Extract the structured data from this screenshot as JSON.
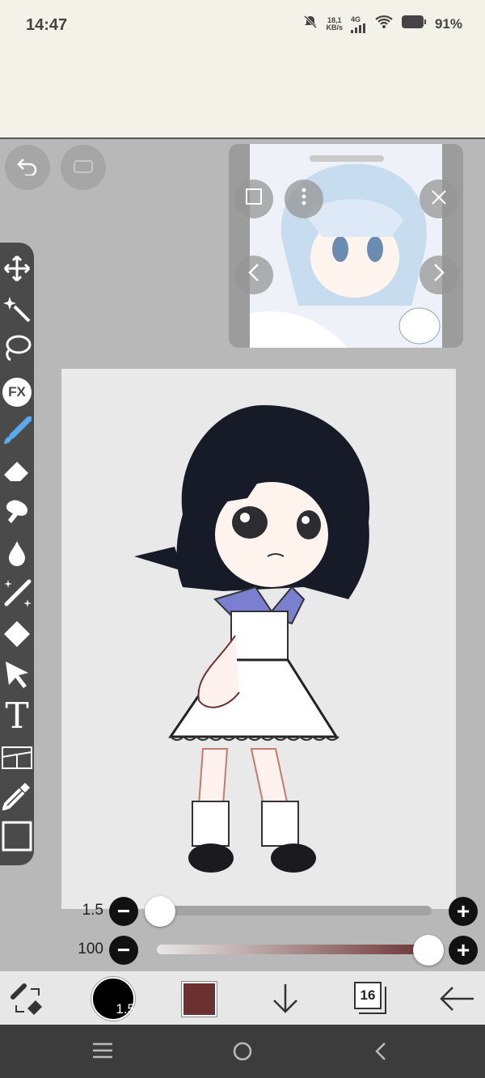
{
  "status": {
    "time": "14:47",
    "speed_top": "18,1",
    "speed_bottom": "KB/s",
    "network": "4G",
    "battery": "91%"
  },
  "colors": {
    "accent": "#6b3131",
    "toolbar": "#4a4a4a",
    "paper": "#e9e9e9"
  },
  "toolbar": {
    "tools": [
      "move-icon",
      "magic-wand-icon",
      "lasso-icon",
      "fx-icon",
      "brush-icon",
      "eraser-icon",
      "smudge-icon",
      "blur-icon",
      "shine-brush-icon",
      "fill-icon",
      "select-arrow-icon",
      "text-icon",
      "frame-divider-icon",
      "eyedropper-icon",
      "canvas-icon"
    ],
    "fx_label": "FX",
    "text_label": "T"
  },
  "sliders": {
    "brush_size": {
      "label": "1.5",
      "value_fraction": 0.0
    },
    "opacity": {
      "label": "100",
      "value_fraction": 1.0
    }
  },
  "bottom": {
    "brush_size_value": "1.5",
    "layer_count": "16"
  },
  "icons": {
    "undo": "undo-icon",
    "redo": "redo-icon",
    "ref_close": "close-icon",
    "ref_prev": "chevron-left-icon",
    "ref_next": "chevron-right-icon"
  }
}
